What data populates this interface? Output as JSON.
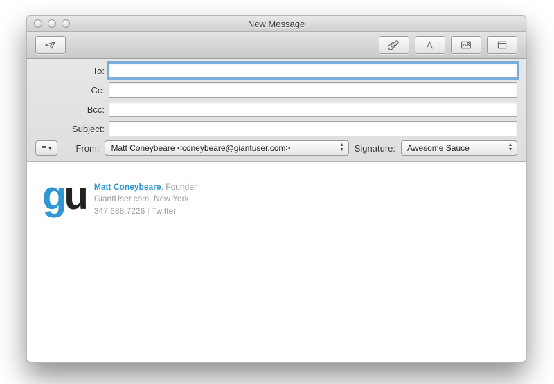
{
  "window": {
    "title": "New Message"
  },
  "fields": {
    "to": {
      "label": "To:",
      "value": ""
    },
    "cc": {
      "label": "Cc:",
      "value": ""
    },
    "bcc": {
      "label": "Bcc:",
      "value": ""
    },
    "subject": {
      "label": "Subject:",
      "value": ""
    }
  },
  "from": {
    "label": "From:",
    "selected": "Matt Coneybeare <coneybeare@giantuser.com>"
  },
  "signature": {
    "label": "Signature:",
    "selected": "Awesome Sauce"
  },
  "sig_block": {
    "logo_g": "g",
    "logo_u": "u",
    "name": "Matt Coneybeare",
    "role": "Founder",
    "site": "GiantUser.com",
    "city": "New York",
    "phone": "347.688.7226",
    "social": "Twitter",
    "sep_comma": ", ",
    "sep_pipe": " | "
  }
}
